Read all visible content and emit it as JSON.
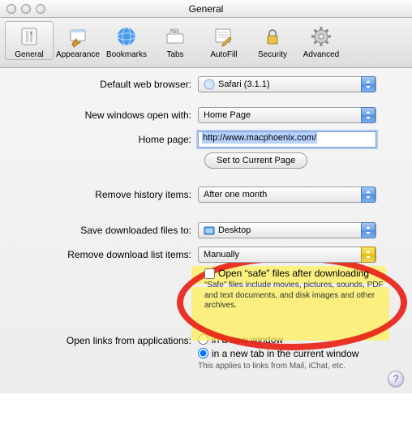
{
  "window": {
    "title": "General"
  },
  "toolbar": {
    "items": [
      {
        "label": "General"
      },
      {
        "label": "Appearance"
      },
      {
        "label": "Bookmarks"
      },
      {
        "label": "Tabs"
      },
      {
        "label": "AutoFill"
      },
      {
        "label": "Security"
      },
      {
        "label": "Advanced"
      }
    ]
  },
  "labels": {
    "default_browser": "Default web browser:",
    "new_windows": "New windows open with:",
    "home_page": "Home page:",
    "remove_history": "Remove history items:",
    "save_downloads": "Save downloaded files to:",
    "remove_downloads": "Remove download list items:",
    "open_links": "Open links from applications:"
  },
  "values": {
    "default_browser": "Safari (3.1.1)",
    "new_windows": "Home Page",
    "home_page_url": "http://www.macphoenix.com/",
    "set_current": "Set to Current Page",
    "remove_history": "After one month",
    "save_downloads": "Desktop",
    "remove_downloads": "Manually",
    "open_safe_label": "Open “safe” files after downloading",
    "open_safe_desc": "“Safe” files include movies, pictures, sounds, PDF and text documents, and disk images and other archives.",
    "links_new_window": "in a new window",
    "links_new_tab": "in a new tab in the current window",
    "links_desc": "This applies to links from Mail, iChat, etc.",
    "help": "?"
  }
}
